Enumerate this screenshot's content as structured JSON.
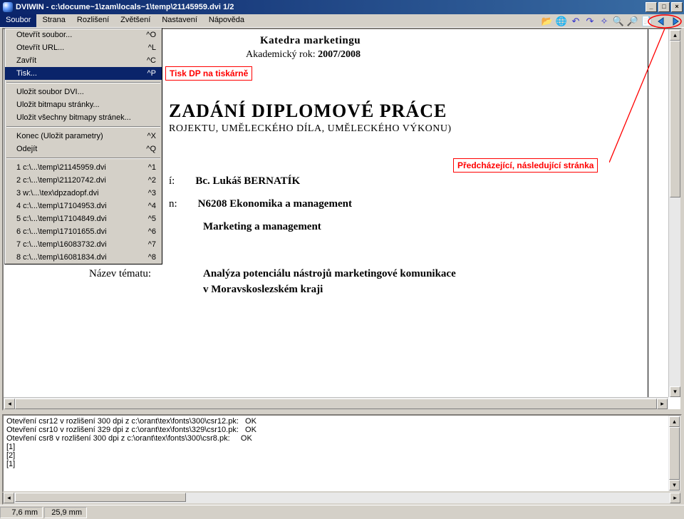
{
  "title": "DVIWIN - c:\\docume~1\\zam\\locals~1\\temp\\21145959.dvi  1/2",
  "menus": [
    "Soubor",
    "Strana",
    "Rozlišení",
    "Zvětšení",
    "Nastavení",
    "Nápověda"
  ],
  "dropdown": {
    "groups": [
      [
        {
          "label": "Otevřít soubor...",
          "accel": "^O"
        },
        {
          "label": "Otevřít URL...",
          "accel": "^L"
        },
        {
          "label": "Zavřít",
          "accel": "^C"
        },
        {
          "label": "Tisk...",
          "accel": "^P",
          "selected": true
        }
      ],
      [
        {
          "label": "Uložit soubor DVI..."
        },
        {
          "label": "Uložit bitmapu stránky..."
        },
        {
          "label": "Uložit všechny bitmapy stránek..."
        }
      ],
      [
        {
          "label": "Konec   (Uložit parametry)",
          "accel": "^X"
        },
        {
          "label": "Odejít",
          "accel": "^Q"
        }
      ],
      [
        {
          "label": "1 c:\\...\\temp\\21145959.dvi",
          "accel": "^1"
        },
        {
          "label": "2 c:\\...\\temp\\21120742.dvi",
          "accel": "^2"
        },
        {
          "label": "3 w:\\...\\tex\\dpzadopf.dvi",
          "accel": "^3"
        },
        {
          "label": "4 c:\\...\\temp\\17104953.dvi",
          "accel": "^4"
        },
        {
          "label": "5 c:\\...\\temp\\17104849.dvi",
          "accel": "^5"
        },
        {
          "label": "6 c:\\...\\temp\\17101655.dvi",
          "accel": "^6"
        },
        {
          "label": "7 c:\\...\\temp\\16083732.dvi",
          "accel": "^7"
        },
        {
          "label": "8 c:\\...\\temp\\16081834.dvi",
          "accel": "^8"
        }
      ]
    ]
  },
  "document": {
    "header1": "Katedra marketingu",
    "header2a": "Akademický rok: ",
    "header2b": "2007/2008",
    "title": "ZADÁNÍ DIPLOMOVÉ PRÁCE",
    "subtitle": "ROJEKTU, UMĚLECKÉHO DÍLA, UMĚLECKÉHO VÝKONU)",
    "row1_suffix": "í:",
    "row1": "Bc. Lukáš BERNATÍK",
    "row2_suffix": "n:",
    "row2": "N6208 Ekonomika a management",
    "row3": "Marketing a management",
    "topic_label": "Název tématu:",
    "topic_val1": "Analýza potenciálu nástrojů marketingové komunikace",
    "topic_val2": "v Moravskoslezském kraji"
  },
  "annotations": {
    "tisk": "Tisk DP na tiskárně",
    "nav": "Předcházející, následující stránka"
  },
  "log": [
    "Otevření csr12 v rozlišení 300 dpi z c:\\orant\\tex\\fonts\\300\\csr12.pk:   OK",
    "Otevření csr10 v rozlišení 329 dpi z c:\\orant\\tex\\fonts\\329\\csr10.pk:   OK",
    "Otevření csr8 v rozlišení 300 dpi z c:\\orant\\tex\\fonts\\300\\csr8.pk:     OK",
    "[1]",
    "[2]",
    "[1]"
  ],
  "status": {
    "x": "7,6 mm",
    "y": "25,9 mm"
  }
}
